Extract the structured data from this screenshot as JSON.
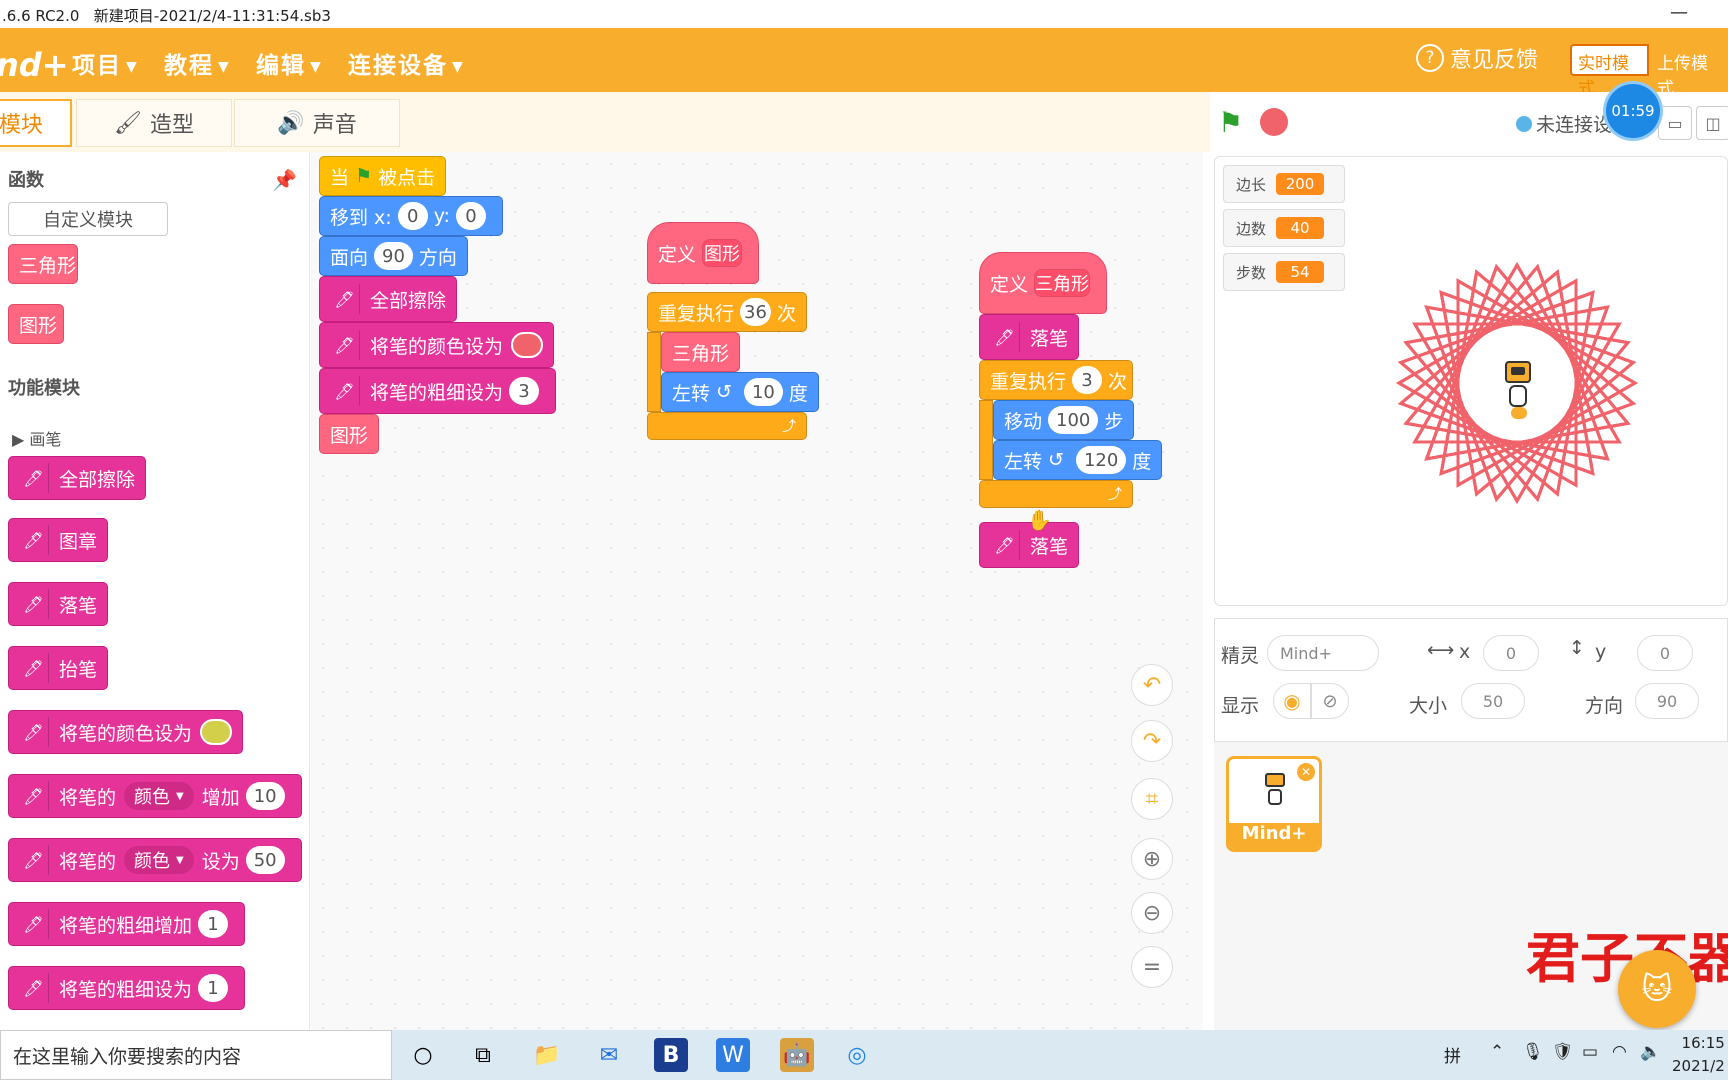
{
  "window": {
    "title": ".6.6 RC2.0   新建项目-2021/2/4-11:31:54.sb3",
    "minimize": "—"
  },
  "menubar": {
    "logo": "nd+",
    "items": [
      "项目",
      "教程",
      "编辑",
      "连接设备"
    ],
    "feedback": "意见反馈",
    "mode_realtime": "实时模式",
    "mode_upload": "上传模式"
  },
  "tabs": [
    "模块",
    "造型",
    "声音"
  ],
  "palette": {
    "section_functions": "函数",
    "custom_block": "自定义模块",
    "fn_blocks": [
      "三角形",
      "图形"
    ],
    "section_modules": "功能模块",
    "category": "画笔",
    "pen_blocks": [
      {
        "text": "全部擦除"
      },
      {
        "text": "图章"
      },
      {
        "text": "落笔"
      },
      {
        "text": "抬笔"
      },
      {
        "text": "将笔的颜色设为"
      },
      {
        "pre": "将笔的",
        "dd": "颜色",
        "mid": "增加",
        "val": "10"
      },
      {
        "pre": "将笔的",
        "dd": "颜色",
        "mid": "设为",
        "val": "50"
      },
      {
        "text": "将笔的粗细增加",
        "val": "1"
      },
      {
        "text": "将笔的粗细设为",
        "val": "1"
      }
    ],
    "colors": {
      "pen_swatch": "#d4cf4a"
    }
  },
  "script1": {
    "hat_when": "当",
    "hat_clicked": "被点击",
    "goto_label": "移到 x:",
    "goto_x": "0",
    "goto_y_label": "y:",
    "goto_y": "0",
    "face_label": "面向",
    "face_val": "90",
    "face_suffix": "方向",
    "clear": "全部擦除",
    "setcolor": "将笔的颜色设为",
    "setsize": "将笔的粗细设为",
    "setsize_val": "3",
    "call": "图形"
  },
  "script2": {
    "define": "定义",
    "name": "图形",
    "repeat": "重复执行",
    "times": "36",
    "times_suffix": "次",
    "call": "三角形",
    "turn": "左转",
    "turn_val": "10",
    "turn_suffix": "度"
  },
  "script3": {
    "define": "定义",
    "name": "三角形",
    "pendown": "落笔",
    "repeat": "重复执行",
    "times": "3",
    "times_suffix": "次",
    "move": "移动",
    "move_val": "100",
    "move_suffix": "步",
    "turn": "左转",
    "turn_val": "120",
    "turn_suffix": "度",
    "pendown2": "落笔"
  },
  "zoom_buttons": [
    "undo-icon",
    "redo-icon",
    "crop-icon",
    "zoom-in-icon",
    "zoom-out-icon",
    "zoom-reset-icon"
  ],
  "stage_toolbar": {
    "connection": "未连接设",
    "timer": "01:59"
  },
  "monitors": [
    {
      "label": "边长",
      "value": "200"
    },
    {
      "label": "边数",
      "value": "40"
    },
    {
      "label": "步数",
      "value": "54"
    }
  ],
  "sprite_info": {
    "sprite_label": "精灵",
    "sprite_name": "Mind+",
    "x_label": "x",
    "x_val": "0",
    "y_label": "y",
    "y_val": "0",
    "show_label": "显示",
    "size_label": "大小",
    "size_val": "50",
    "dir_label": "方向",
    "dir_val": "90"
  },
  "sprite_list": {
    "sprite": "Mind+"
  },
  "overlay_text": "君子不器",
  "taskbar": {
    "search_placeholder": "在这里输入你要搜索的内容",
    "ime": "拼",
    "time": "16:15",
    "date": "2021/2"
  },
  "colors": {
    "accent": "#f8ad2c",
    "pen": "#e6339a",
    "motion": "#4c97ff",
    "control": "#ffab19",
    "function": "#ff6680",
    "drawing": "#f0636a"
  }
}
